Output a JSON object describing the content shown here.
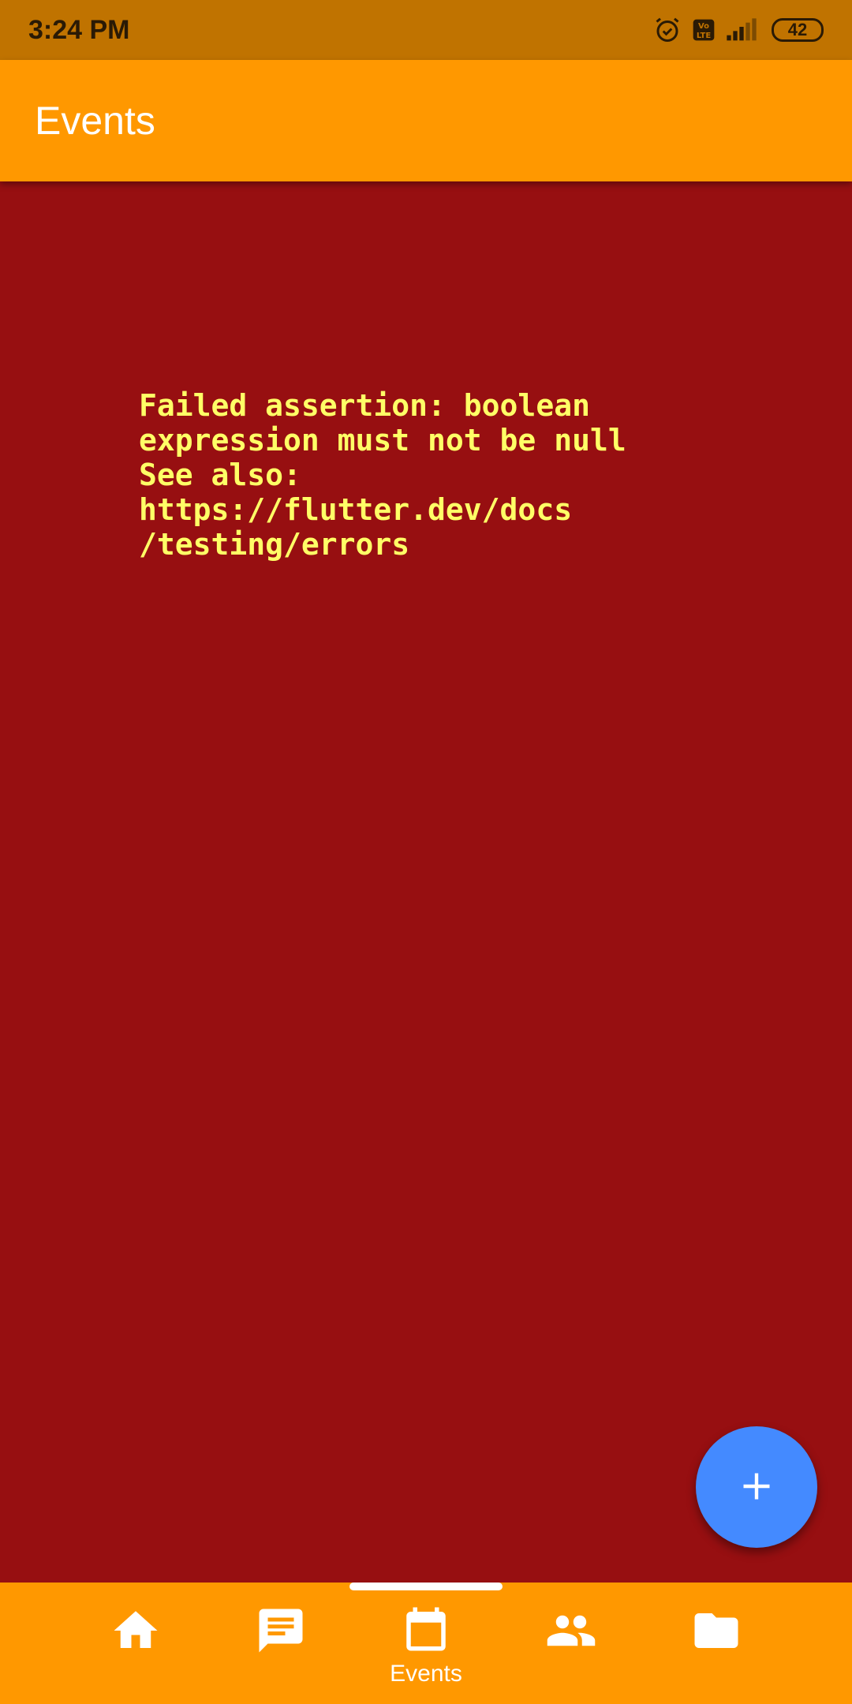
{
  "status_bar": {
    "time": "3:24 PM",
    "battery": "42",
    "icons": [
      "alarm-icon",
      "volte-icon",
      "signal-icon",
      "battery-icon"
    ]
  },
  "app_bar": {
    "title": "Events"
  },
  "error": {
    "message": "Failed assertion: boolean\nexpression must not be null\nSee also:\nhttps://flutter.dev/docs\n/testing/errors"
  },
  "fab": {
    "icon": "plus-icon"
  },
  "bottom_nav": {
    "items": [
      {
        "icon": "home-icon",
        "label": ""
      },
      {
        "icon": "chat-icon",
        "label": ""
      },
      {
        "icon": "calendar-icon",
        "label": "Events"
      },
      {
        "icon": "people-icon",
        "label": ""
      },
      {
        "icon": "folder-icon",
        "label": ""
      }
    ],
    "active_index": 2
  },
  "colors": {
    "status_bar": "#c07300",
    "app_bar": "#ff9800",
    "background": "#970f11",
    "error_text": "#ffff66",
    "fab": "#448aff"
  }
}
